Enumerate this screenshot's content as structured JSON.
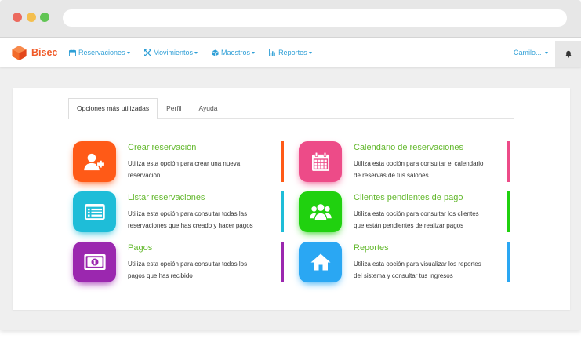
{
  "browser": {
    "close_color": "#ec6a5e",
    "minimize_color": "#f4bf4f",
    "maximize_color": "#61c554"
  },
  "navbar": {
    "brand": "Bisec",
    "brand_color": "#f05a28",
    "logo_icon": "bisec-logo-icon",
    "link_color": "#2f9fd6",
    "menu": [
      {
        "label": "Reservaciones",
        "icon": "calendar-icon"
      },
      {
        "label": "Movimientos",
        "icon": "arrows-icon"
      },
      {
        "label": "Maestros",
        "icon": "cube-icon"
      },
      {
        "label": "Reportes",
        "icon": "bar-chart-icon"
      }
    ],
    "user_menu": {
      "label": "Camilo...",
      "icon": "caret-down-icon"
    },
    "notifications_icon": "bell-icon"
  },
  "tabs": [
    {
      "label": "Opciones más utilizadas",
      "active": true
    },
    {
      "label": "Perfil",
      "active": false
    },
    {
      "label": "Ayuda",
      "active": false
    }
  ],
  "option_title_color": "#63b82d",
  "options": [
    {
      "title": "Crear reservación",
      "description": [
        "Utiliza esta opción para crear una nueva",
        "reservación"
      ],
      "icon": "user-plus-icon",
      "color": "#ff5a17"
    },
    {
      "title": "Calendario de reservaciones",
      "description": [
        "Utiliza esta opción para consultar el calendario",
        "de reservas de tus salones"
      ],
      "icon": "calendar-icon",
      "color": "#ed4b88"
    },
    {
      "title": "Listar reservaciones",
      "description": [
        "Utiliza esta opción para consultar todas las",
        "reservaciones que has creado y hacer pagos"
      ],
      "icon": "list-alt-icon",
      "color": "#1ebdd8"
    },
    {
      "title": "Clientes pendientes de pago",
      "description": [
        "Utiliza esta opción para consultar los clientes",
        "que están pendientes de realizar pagos"
      ],
      "icon": "users-icon",
      "color": "#20d10f"
    },
    {
      "title": "Pagos",
      "description": [
        "Utiliza esta opción para consultar todos los",
        "pagos que has recibido"
      ],
      "icon": "money-icon",
      "color": "#9b27af"
    },
    {
      "title": "Reportes",
      "description": [
        "Utiliza esta opción para visualizar los reportes",
        "del sistema y consultar tus ingresos"
      ],
      "icon": "home-icon",
      "color": "#2aa7f3"
    }
  ]
}
